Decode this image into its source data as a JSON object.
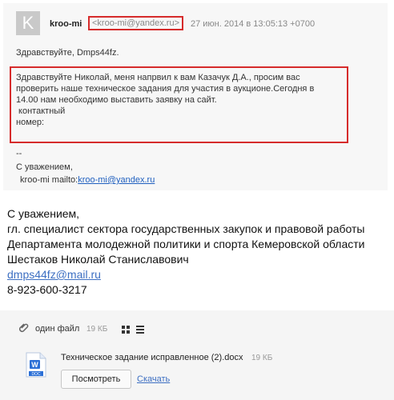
{
  "header": {
    "avatar_letter": "K",
    "sender": "kroo-mi",
    "email": "<kroo-mi@yandex.ru>",
    "date": "27 июн. 2014 в 13:05:13 +0700"
  },
  "quoted": {
    "greeting": "Здравствуйте, Dmps44fz.",
    "message_lines": [
      "Здравствуйте Николай, меня напрвил к вам Казачук Д.А., просим вас",
      "проверить наше техническое задания для участия в аукционе.Сегодня в",
      "14.00 нам необходимо выставить заявку на сайт.",
      " контактный",
      "номер:"
    ],
    "sig_dash": "--",
    "regards": "С уважением,",
    "mailto_prefix": " kroo-mi mailto:",
    "mailto_link": "kroo-mi@yandex.ru"
  },
  "signature": {
    "lines": [
      "С уважением,",
      "гл. специалист сектора государственных закупок и правовой работы",
      "Департамента молодежной политики и спорта Кемеровской области",
      "Шестаков Николай Станиславович"
    ],
    "email": "dmps44fz@mail.ru",
    "phone": "8-923-600-3217"
  },
  "attachments": {
    "label": "один файл",
    "total_size": "19 КБ",
    "file": {
      "name": "Техническое задание исправленное (2).docx",
      "size": "19 КБ",
      "icon_text": "DOC",
      "view_label": "Посмотреть",
      "download_label": "Скачать"
    }
  },
  "colors": {
    "highlight": "#d62b2b",
    "link": "#3d6fc2",
    "word": "#2b6fd6"
  }
}
